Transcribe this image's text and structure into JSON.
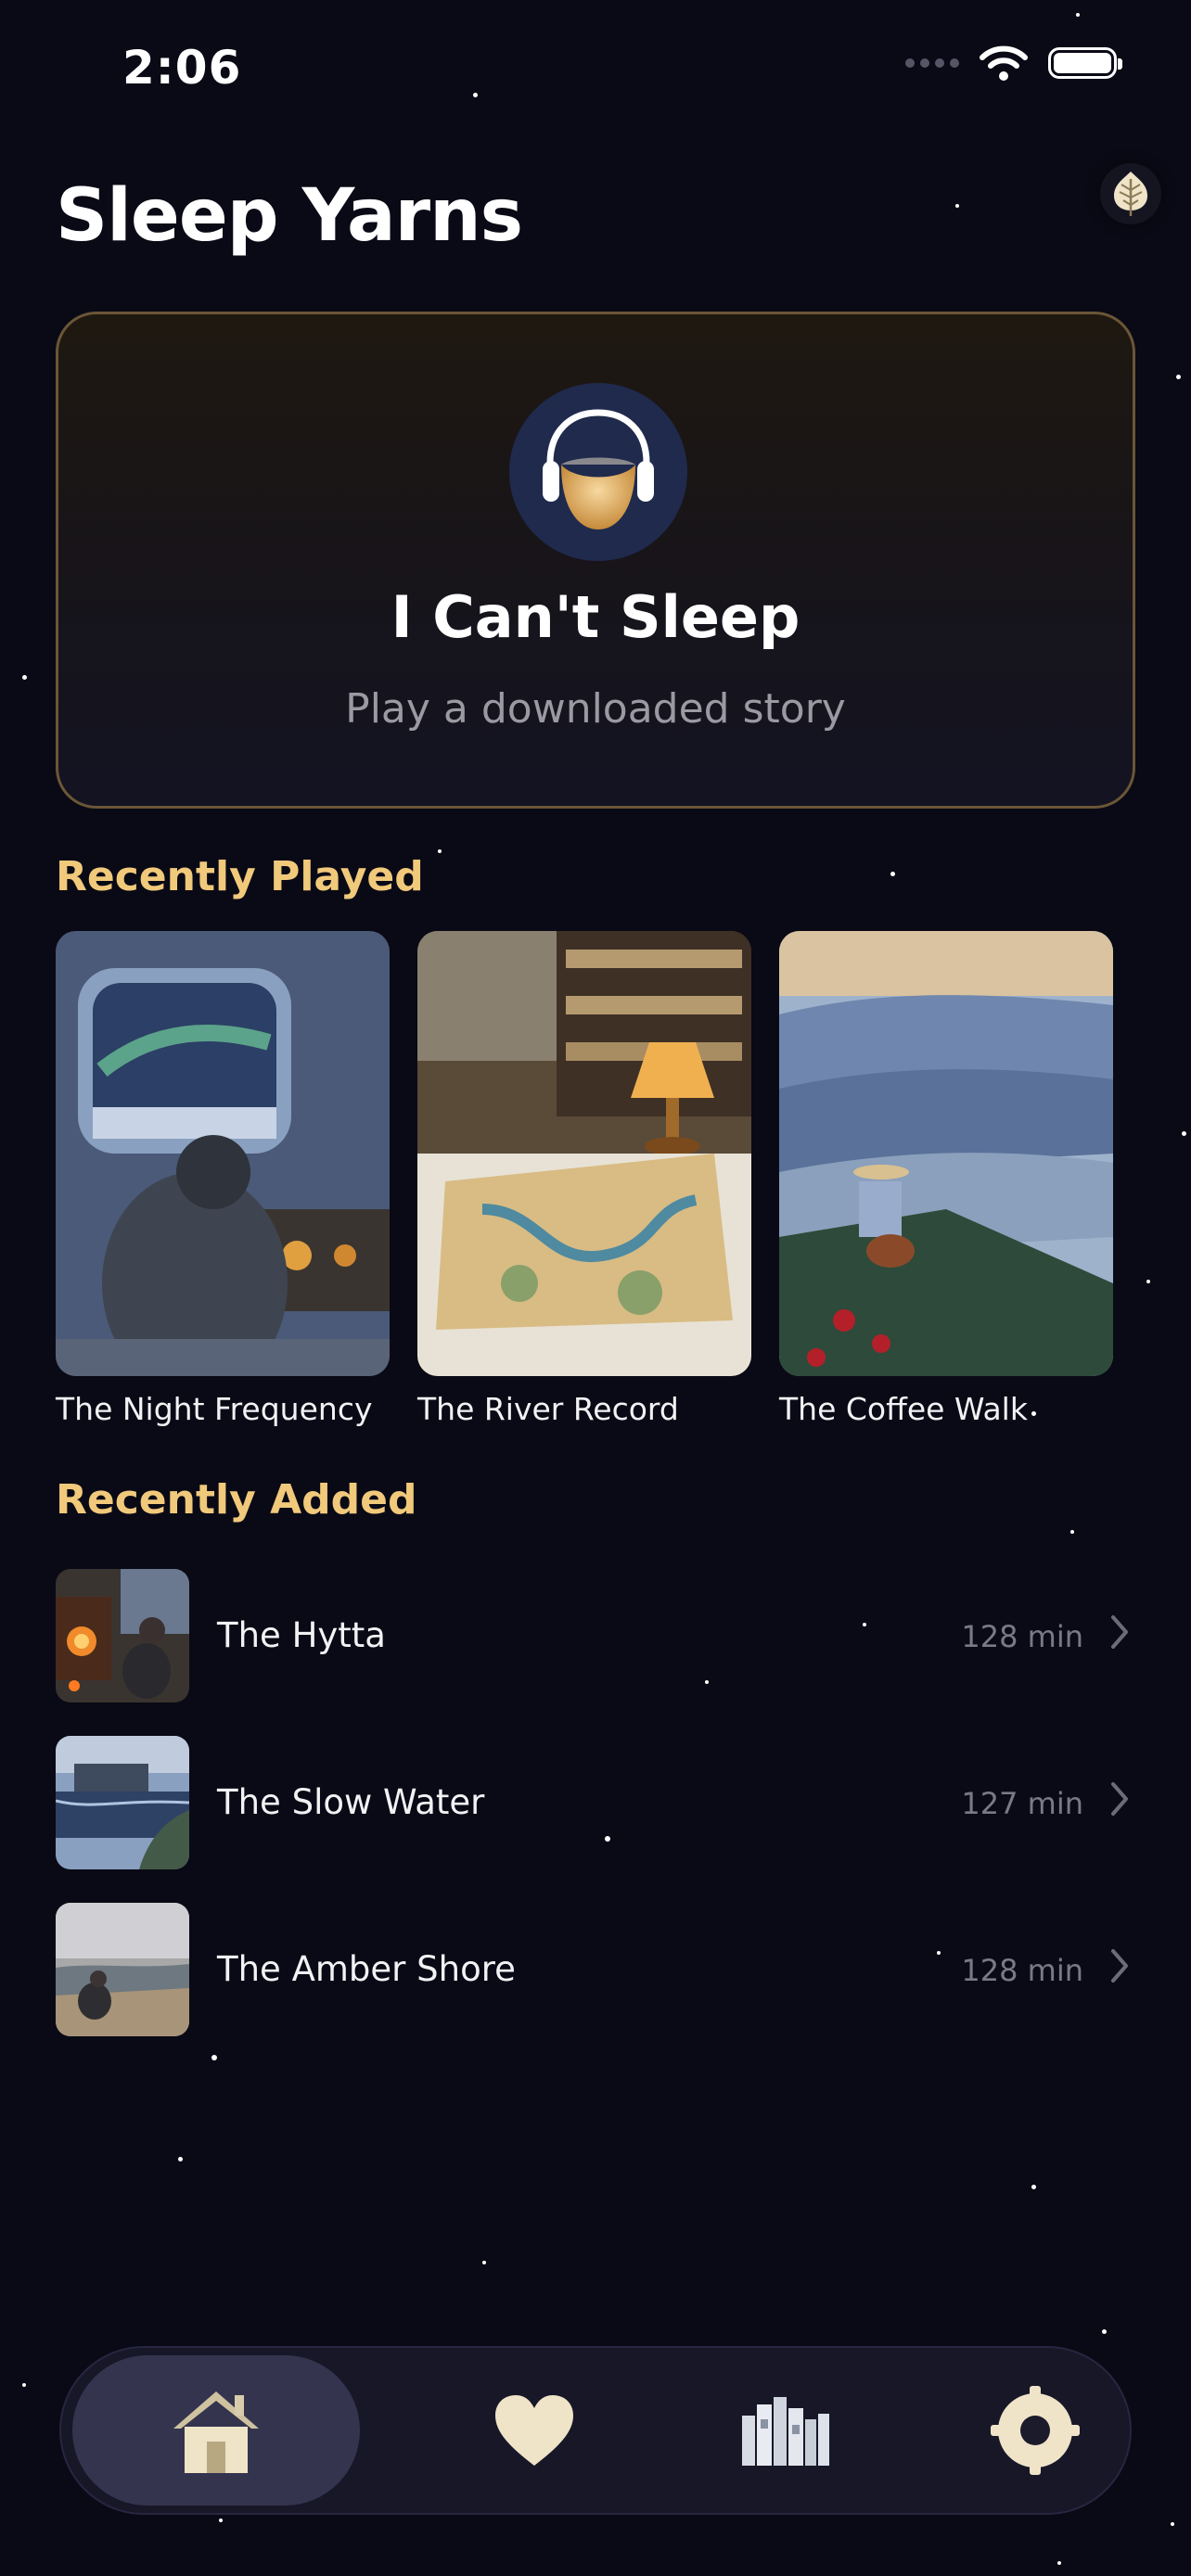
{
  "status_bar": {
    "time": "2:06"
  },
  "header": {
    "title": "Sleep Yarns",
    "leaf_icon": "leaf-icon"
  },
  "hero": {
    "icon": "moon-headphones-icon",
    "title": "I Can't Sleep",
    "subtitle": "Play a downloaded story",
    "border_color": "#6b5636"
  },
  "recently_played": {
    "heading": "Recently Played",
    "items": [
      {
        "title": "The Night Frequency"
      },
      {
        "title": "The River Record"
      },
      {
        "title": "The Coffee Walk"
      }
    ]
  },
  "recently_added": {
    "heading": "Recently Added",
    "items": [
      {
        "title": "The Hytta",
        "duration": "128 min"
      },
      {
        "title": "The Slow Water",
        "duration": "127 min"
      },
      {
        "title": "The Amber Shore",
        "duration": "128 min"
      }
    ]
  },
  "tab_bar": {
    "tabs": [
      {
        "icon": "home-icon",
        "selected": true
      },
      {
        "icon": "heart-icon",
        "selected": false
      },
      {
        "icon": "books-icon",
        "selected": false
      },
      {
        "icon": "gear-icon",
        "selected": false
      }
    ]
  },
  "colors": {
    "background": "#0a0a16",
    "accent": "#f1c97b",
    "icon_cream": "#efe4c8"
  }
}
